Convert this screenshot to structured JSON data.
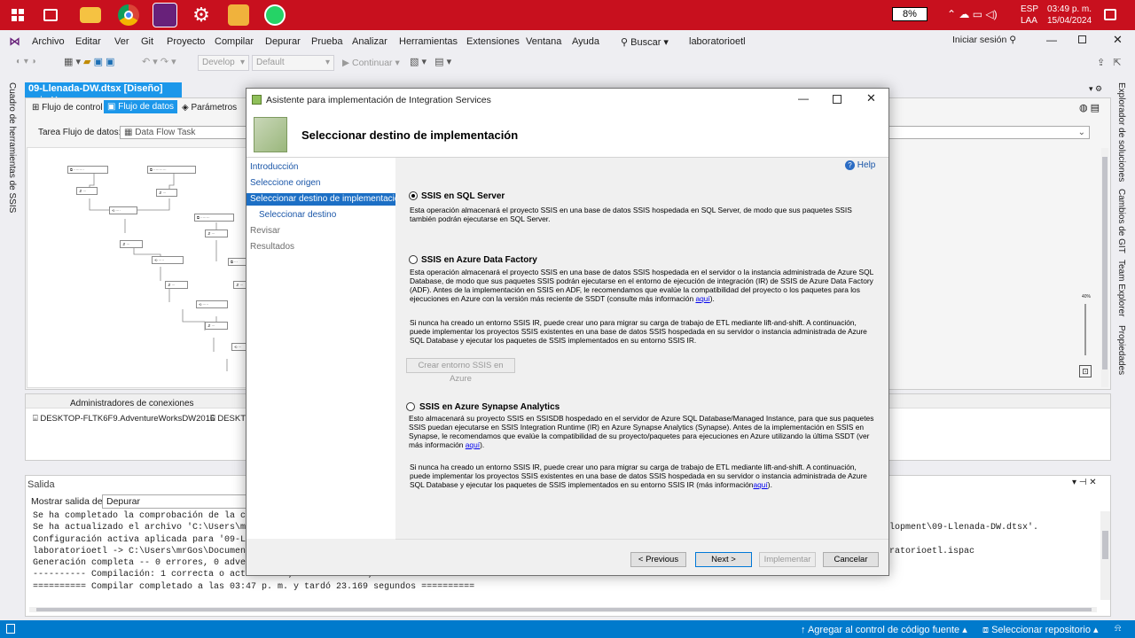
{
  "taskbar": {
    "battery": "8%",
    "lang": "ESP",
    "layout": "LAA",
    "time": "03:49 p. m.",
    "date": "15/04/2024"
  },
  "vs": {
    "menu": [
      "Archivo",
      "Editar",
      "Ver",
      "Git",
      "Proyecto",
      "Compilar",
      "Depurar",
      "Prueba",
      "Analizar",
      "Herramientas",
      "Extensiones",
      "Ventana",
      "Ayuda"
    ],
    "search": "Buscar",
    "solution": "laboratorioetl",
    "signin": "Iniciar sesión",
    "toolbar": {
      "config": "Develop",
      "platform": "Default",
      "continue": "Continuar"
    },
    "left_strip": "Cuadro de herramientas de SSIS",
    "right_strip": [
      "Explorador de soluciones",
      "Cambios de GIT",
      "Team Explorer",
      "Propiedades"
    ],
    "doc_tab": "09-Llenada-DW.dtsx [Diseño]",
    "designer_tabs": [
      "Flujo de control",
      "Flujo de datos",
      "Parámetros"
    ],
    "task_label": "Tarea Flujo de datos:",
    "task_value": "Data Flow Task",
    "zoom": "40%",
    "connmgr_title": "Administradores de conexiones",
    "connections": [
      "DESKTOP-FLTK6F9.AdventureWorksDW2016",
      "DESKT"
    ],
    "output_title": "Salida",
    "output_show": "Mostrar salida de:",
    "output_source": "Depurar",
    "output_lines": [
      "Se ha completado la comprobación de la coher",
      "Se ha actualizado el archivo 'C:\\Users\\mrGos\\",
      "Configuración activa aplicada para '09-Llenad",
      "laboratorioetl -> C:\\Users\\mrGos\\Documents\\Es",
      "Generación completa -- 0 errores, 0 advertenc",
      "---------- Compilación: 1 correcta o actualizada, 0 con errores, 0 omitida ----------",
      "========== Compilar completado a las 03:47 p. m. y tardó 23.169 segundos =========="
    ],
    "output_right": [
      "lopment\\09-Llenada-DW.dtsx'.",
      "ratorioetl.ispac"
    ],
    "status_left": "",
    "status_source": "Agregar al control de código fuente",
    "status_repo": "Seleccionar repositorio"
  },
  "dialog": {
    "title": "Asistente para implementación de Integration Services",
    "header": "Seleccionar destino de implementación",
    "nav": [
      "Introducción",
      "Seleccione origen",
      "Seleccionar destino de implementación",
      "Seleccionar destino",
      "Revisar",
      "Resultados"
    ],
    "help": "Help",
    "options": [
      {
        "label": "SSIS en SQL Server",
        "selected": true,
        "desc": "Esta operación almacenará el proyecto SSIS en una base de datos SSIS hospedada en SQL Server, de modo que sus paquetes SSIS también podrán ejecutarse en SQL Server."
      },
      {
        "label": "SSIS en Azure Data Factory",
        "selected": false,
        "desc": "Esta operación almacenará el proyecto SSIS en una base de datos SSIS hospedada en el servidor o la instancia administrada de Azure SQL Database, de modo que sus paquetes SSIS podrán ejecutarse en el entorno de ejecución de integración (IR) de SSIS de Azure Data Factory (ADF). Antes de la implementación en SSIS en ADF, le recomendamos que evalúe la compatibilidad del proyecto o los paquetes para los ejecuciones en Azure con la versión más reciente de SSDT (consulte más información ",
        "link": "aquí",
        "desc_end": ").",
        "desc2": "Si nunca ha creado un entorno SSIS IR, puede crear uno para migrar su carga de trabajo de ETL mediante lift-and-shift. A continuación, puede implementar los proyectos SSIS existentes en una base de datos SSIS hospedada en su servidor o instancia administrada de Azure SQL Database y ejecutar los paquetes de SSIS implementados en su entorno SSIS IR.",
        "button": "Crear entorno SSIS en Azure"
      },
      {
        "label": "SSIS en Azure Synapse Analytics",
        "selected": false,
        "desc": "Esto almacenará su proyecto SSIS en SSISDB hospedado en el servidor de Azure SQL Database/Managed Instance, para que sus paquetes SSIS puedan ejecutarse en SSIS Integration Runtime (IR) en Azure Synapse Analytics (Synapse). Antes de la implementación en SSIS en Synapse, le recomendamos que evalúe la compatibilidad de su proyecto/paquetes para ejecuciones en Azure utilizando la última SSDT (ver más información ",
        "link": "aquí",
        "desc_end": ").",
        "desc2": "Si nunca ha creado un entorno SSIS IR, puede crear uno para migrar su carga de trabajo de ETL mediante lift-and-shift. A continuación, puede implementar los proyectos SSIS existentes en una base de datos SSIS hospedada en su servidor o instancia administrada de Azure SQL Database y ejecutar los paquetes de SSIS implementados en su entorno SSIS IR (más información",
        "link2": "aquí",
        "desc2_end": ")."
      }
    ],
    "buttons": {
      "prev": "< Previous",
      "next": "Next >",
      "deploy": "Implementar",
      "cancel": "Cancelar"
    }
  }
}
